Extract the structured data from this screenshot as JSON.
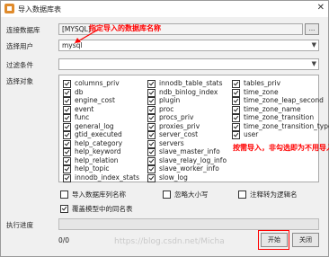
{
  "window": {
    "title": "导入数据库表",
    "close": "✕"
  },
  "form": {
    "db_label": "连接数据库",
    "db_value": "[MYSQL]",
    "browse_label": "...",
    "user_label": "选择用户",
    "user_value": "mysql",
    "filter_label": "过滤条件",
    "filter_value": "",
    "objects_label": "选择对象",
    "progress_label": "执行进度"
  },
  "annotations": {
    "db_hint": "指定导入的数据库名称",
    "import_hint": "按需导入，非勾选即为不用导入"
  },
  "objects": {
    "col1": [
      "columns_priv",
      "db",
      "engine_cost",
      "event",
      "func",
      "general_log",
      "gtid_executed",
      "help_category",
      "help_keyword",
      "help_relation",
      "help_topic",
      "innodb_index_stats"
    ],
    "col2": [
      "innodb_table_stats",
      "ndb_binlog_index",
      "plugin",
      "proc",
      "procs_priv",
      "proxies_priv",
      "server_cost",
      "servers",
      "slave_master_info",
      "slave_relay_log_info",
      "slave_worker_info",
      "slow_log"
    ],
    "col3": [
      "tables_priv",
      "time_zone",
      "time_zone_leap_second",
      "time_zone_name",
      "time_zone_transition",
      "time_zone_transition_type",
      "user"
    ]
  },
  "options": {
    "import_comment": "导入数据库列名称",
    "case_sensitive": "忽略大小写",
    "comment_to_logical": "注释转为逻辑名",
    "overwrite": "覆盖模型中的同名表"
  },
  "status": {
    "progress_count": "0/0",
    "progress_value": 0,
    "watermark": "https://blog.csdn.net/Micha"
  },
  "buttons": {
    "start": "开始",
    "close": "关闭"
  }
}
